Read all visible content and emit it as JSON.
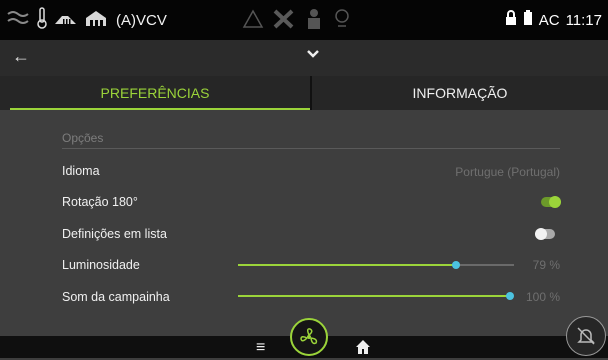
{
  "status_bar": {
    "mode": "(A)VCV",
    "ac_label": "AC",
    "time": "11:17",
    "icons": [
      "airflow-icon",
      "thermometer-icon",
      "heater-icon",
      "house-icon",
      "warning-triangle-icon",
      "tools-icon",
      "service-person-icon",
      "filter-icon",
      "lock-icon",
      "battery-icon"
    ]
  },
  "top_bar": {
    "back_icon": "back-arrow-icon",
    "dropdown_icon": "chevron-down-icon"
  },
  "tabs": [
    {
      "label": "PREFERÊNCIAS",
      "active": true
    },
    {
      "label": "INFORMAÇÃO",
      "active": false
    }
  ],
  "settings": {
    "section_title": "Opções",
    "language": {
      "label": "Idioma",
      "value": "Portugue (Portugal)"
    },
    "rotation": {
      "label": "Rotação 180°",
      "enabled": true
    },
    "list_definitions": {
      "label": "Definições em lista",
      "enabled": false
    },
    "brightness": {
      "label": "Luminosidade",
      "value_text": "79 %",
      "level": 0.79
    },
    "doorbell_sound": {
      "label": "Som da campainha",
      "value_text": "100 %",
      "level": 1.0
    }
  },
  "bottom_bar": {
    "icons": [
      "menu-icon",
      "fan-icon",
      "home-icon",
      "bell-off-icon"
    ]
  },
  "colors": {
    "accent": "#9bd43a",
    "slider_thumb": "#4cc3e0",
    "background": "#3e3e3e"
  }
}
